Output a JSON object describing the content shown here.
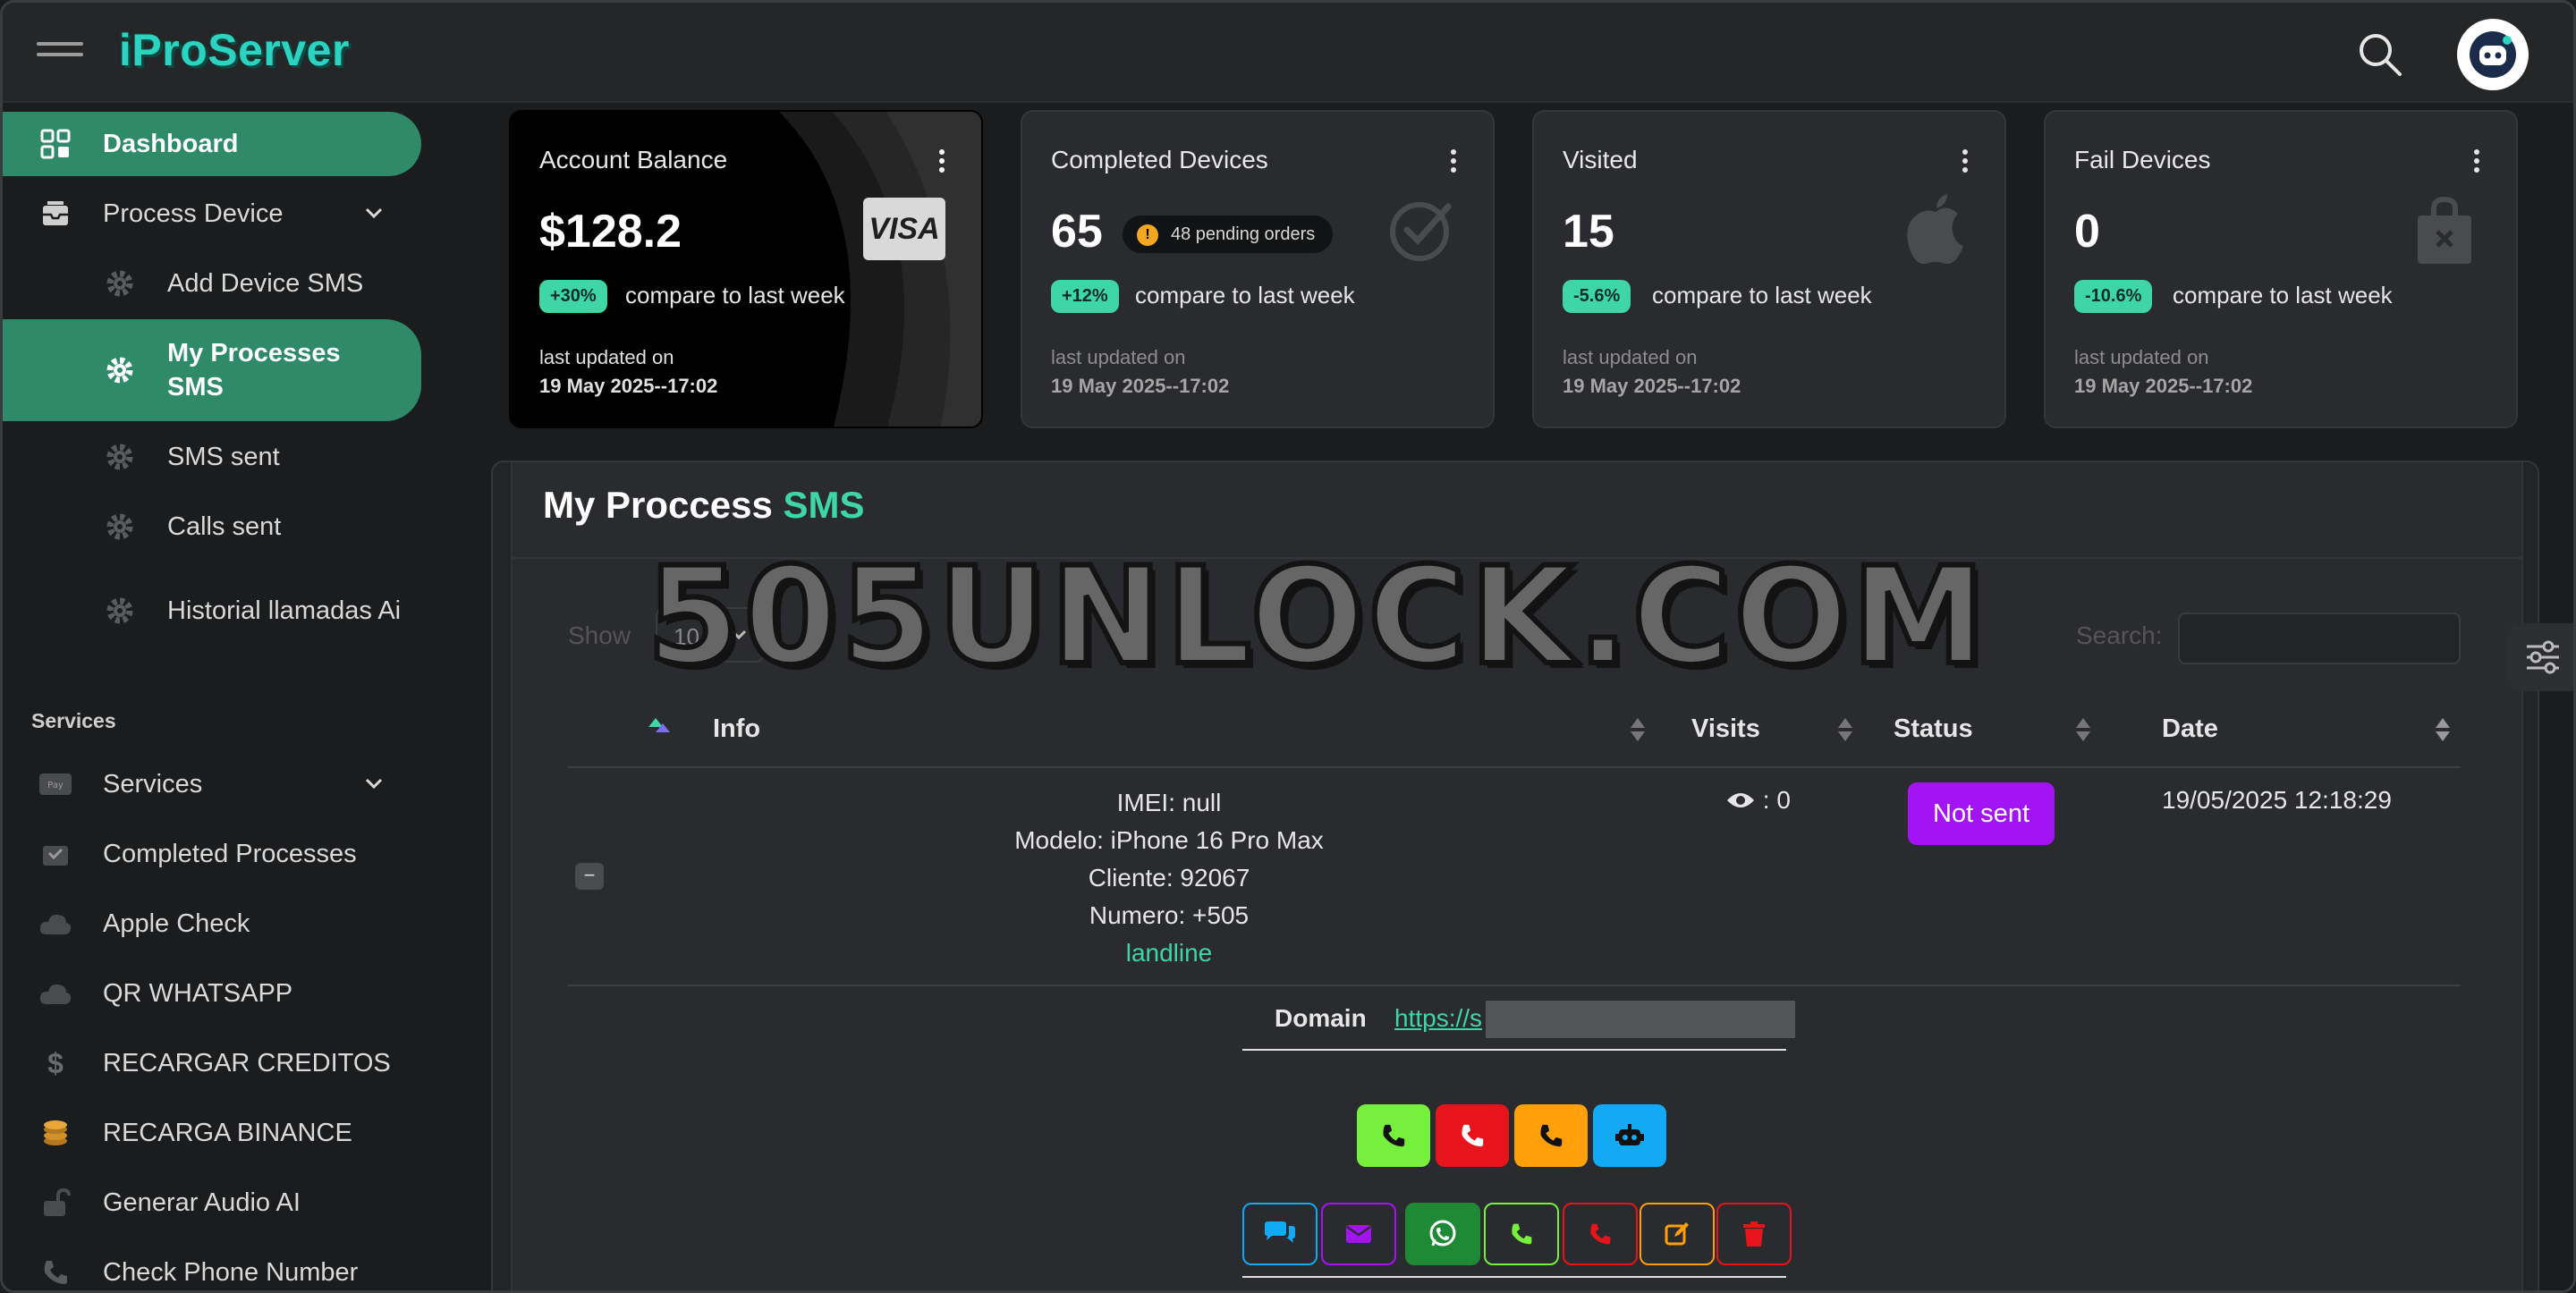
{
  "app": {
    "brand": "iProServer"
  },
  "sidebar": {
    "dashboard": "Dashboard",
    "process_device": "Process Device",
    "add_device_sms": "Add Device SMS",
    "my_processes_sms": "My Processes SMS",
    "sms_sent": "SMS sent",
    "calls_sent": "Calls sent",
    "historial": "Historial llamadas Ai",
    "services_section": "Services",
    "services": "Services",
    "completed_processes": "Completed Processes",
    "apple_check": "Apple Check",
    "qr_whatsapp": "QR WHATSAPP",
    "recargar_creditos": "RECARGAR CREDITOS",
    "recarga_binance": "RECARGA BINANCE",
    "generar_audio": "Generar Audio AI",
    "check_phone": "Check Phone Number"
  },
  "cards": [
    {
      "title": "Account Balance",
      "value": "$128.2",
      "change": "+30%",
      "compare": "compare to last week",
      "updated_label": "last updated on",
      "updated": "19 May 2025--17:02",
      "badge": "VISA"
    },
    {
      "title": "Completed Devices",
      "value": "65",
      "pending": "48 pending orders",
      "change": "+12%",
      "compare": "compare to last week",
      "updated_label": "last updated on",
      "updated": "19 May 2025--17:02"
    },
    {
      "title": "Visited",
      "value": "15",
      "change": "-5.6%",
      "compare": "compare to last week",
      "updated_label": "last updated on",
      "updated": "19 May 2025--17:02"
    },
    {
      "title": "Fail Devices",
      "value": "0",
      "change": "-10.6%",
      "compare": "compare to last week",
      "updated_label": "last updated on",
      "updated": "19 May 2025--17:02"
    }
  ],
  "panel": {
    "title_main": "My Proccess",
    "title_accent": "SMS",
    "watermark": "505UNLOCK.COM",
    "show_label": "Show",
    "show_value": "10",
    "search_label": "Search:"
  },
  "table": {
    "columns": [
      "Info",
      "Visits",
      "Status",
      "Date"
    ],
    "row": {
      "imei": "IMEI: null",
      "modelo": "Modelo: iPhone 16 Pro Max",
      "cliente": "Cliente: 92067",
      "numero": "Numero: +505",
      "type": "landline",
      "visits": ": 0",
      "status": "Not sent",
      "date": "19/05/2025 12:18:29",
      "expander": "−"
    },
    "domain_label": "Domain",
    "domain_value": "https://s"
  },
  "colors": {
    "accent": "#3fd6a6",
    "active_nav": "#2f8a6a",
    "status_purple": "#a314f5"
  }
}
